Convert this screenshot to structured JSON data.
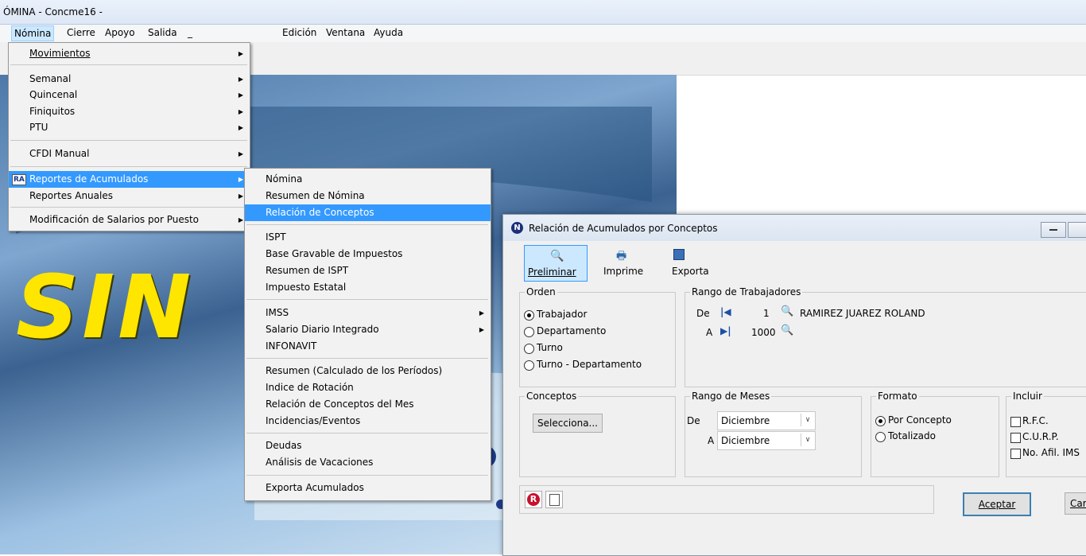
{
  "window": {
    "title": "ÓMINA - Concme16 -"
  },
  "menubar": {
    "items": [
      "Nómina",
      "Cierre",
      "Apoyo",
      "Salida",
      "_",
      "Edición",
      "Ventana",
      "Ayuda"
    ]
  },
  "nomina_menu": {
    "items": [
      {
        "label": "Movimientos"
      },
      {
        "label": "Semanal"
      },
      {
        "label": "Quincenal"
      },
      {
        "label": "Finiquitos"
      },
      {
        "label": "PTU"
      },
      {
        "label": "CFDI Manual"
      },
      {
        "label": "Reportes de Acumulados",
        "badge": "RA"
      },
      {
        "label": "Reportes Anuales"
      },
      {
        "label": "Modificación de Salarios por Puesto"
      }
    ]
  },
  "acumulados_menu": {
    "items": [
      "Nómina",
      "Resumen de Nómina",
      "Relación de Conceptos",
      "ISPT",
      "Base Gravable de Impuestos",
      "Resumen de ISPT",
      "Impuesto Estatal",
      "IMSS",
      "Salario Diario Integrado",
      "INFONAVIT",
      "Resumen (Calculado de los Períodos)",
      "Indice de Rotación",
      "Relación de Conceptos del Mes",
      "Incidencias/Eventos",
      "Deudas",
      "Análisis de Vacaciones",
      "Exporta Acumulados"
    ]
  },
  "background": {
    "text": "SIN"
  },
  "dialog": {
    "title": "Relación de Acumulados por Conceptos",
    "toolbar": {
      "preliminar": "Preliminar",
      "imprime": "Imprime",
      "exporta": "Exporta"
    },
    "orden": {
      "title": "Orden",
      "options": [
        "Trabajador",
        "Departamento",
        "Turno",
        "Turno - Departamento"
      ],
      "selected": "Trabajador"
    },
    "rango_trabajadores": {
      "title": "Rango de Trabajadores",
      "de_label": "De",
      "de_value": "1",
      "de_name": "RAMIREZ JUAREZ ROLAND",
      "a_label": "A",
      "a_value": "1000"
    },
    "conceptos": {
      "title": "Conceptos",
      "button": "Selecciona..."
    },
    "rango_meses": {
      "title": "Rango de Meses",
      "de_label": "De",
      "de_value": "Diciembre",
      "a_label": "A",
      "a_value": "Diciembre"
    },
    "formato": {
      "title": "Formato",
      "options": [
        "Por Concepto",
        "Totalizado"
      ],
      "selected": "Por Concepto"
    },
    "incluir": {
      "title": "Incluir",
      "options": [
        "R.F.C.",
        "C.U.R.P.",
        "No. Afil. IMS"
      ]
    },
    "buttons": {
      "aceptar": "Aceptar",
      "cancelar": "Car"
    }
  }
}
